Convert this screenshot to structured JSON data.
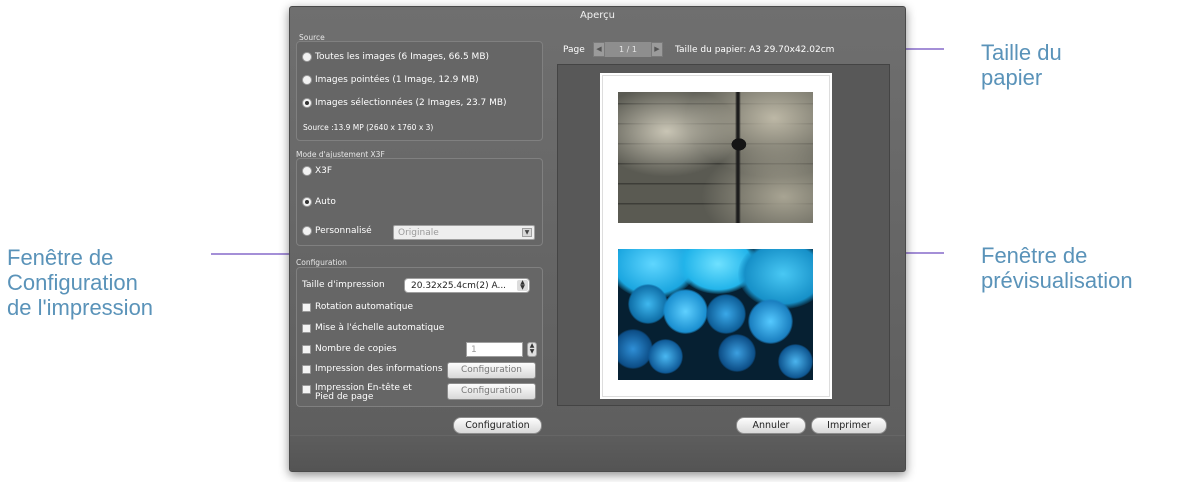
{
  "annotations": {
    "paper_size": "Taille du\npapier",
    "preview_window": "Fenêtre de\nprévisualisation",
    "print_config": "Fenêtre de\nConfiguration\nde l'impression"
  },
  "window": {
    "title": "Aperçu"
  },
  "source": {
    "label": "Source",
    "options": [
      {
        "label": "Toutes les images  (6 Images, 66.5 MB)",
        "selected": false
      },
      {
        "label": "Images pointées  (1 Image, 12.9 MB)",
        "selected": false
      },
      {
        "label": "Images sélectionnées  (2 Images, 23.7 MB)",
        "selected": true
      }
    ],
    "info": "Source :13.9 MP (2640 x 1760 x 3)"
  },
  "x3f_mode": {
    "label": "Mode d'ajustement X3F",
    "options": [
      {
        "label": "X3F",
        "selected": false
      },
      {
        "label": "Auto",
        "selected": true
      },
      {
        "label": "Personnalisé",
        "selected": false
      }
    ],
    "custom_select_value": "Originale"
  },
  "configuration": {
    "label": "Configuration",
    "print_size_label": "Taille d'impression",
    "print_size_value": "20.32x25.4cm(2) A...",
    "auto_rotation": "Rotation automatique",
    "auto_scale": "Mise à l'échelle automatique",
    "copies_label": "Nombre de copies",
    "copies_value": "1",
    "print_info": "Impression des informations",
    "print_info_button": "Configuration",
    "header_footer": "Impression En-tête et Pied de page",
    "header_footer_button": "Configuration",
    "config_button": "Configuration"
  },
  "preview": {
    "page_label": "Page",
    "page_value": "1 / 1",
    "paper_size": "Taille du papier: A3  29.70x42.02cm"
  },
  "footer": {
    "cancel": "Annuler",
    "print": "Imprimer"
  },
  "colors": {
    "annotation_text": "#5a93b9",
    "annotation_arrow": "#a48fd7",
    "window_bg": "#666666"
  }
}
